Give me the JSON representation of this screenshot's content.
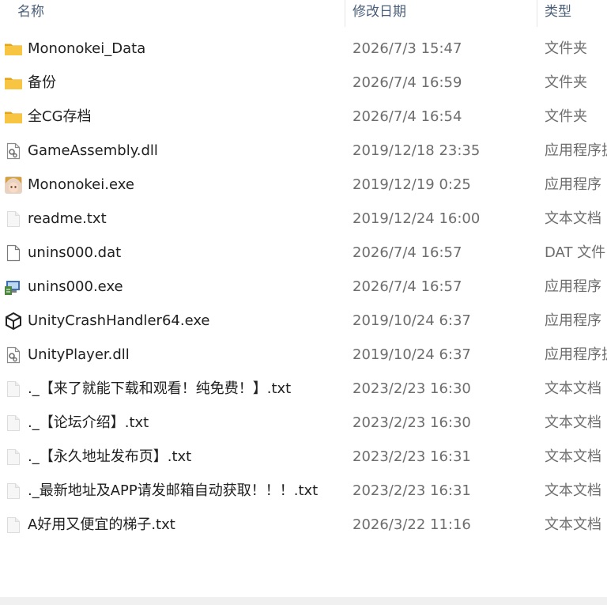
{
  "columns": {
    "name": "名称",
    "date": "修改日期",
    "type": "类型"
  },
  "files": [
    {
      "name": "Mononokei_Data",
      "date": "2026/7/3 15:47",
      "type": "文件夹",
      "icon": "folder-icon"
    },
    {
      "name": "备份",
      "date": "2026/7/4 16:59",
      "type": "文件夹",
      "icon": "folder-icon"
    },
    {
      "name": "全CG存档",
      "date": "2026/7/4 16:54",
      "type": "文件夹",
      "icon": "folder-icon"
    },
    {
      "name": "GameAssembly.dll",
      "date": "2019/12/18 23:35",
      "type": "应用程序扩展",
      "icon": "dll-file-icon"
    },
    {
      "name": "Mononokei.exe",
      "date": "2019/12/19 0:25",
      "type": "应用程序",
      "icon": "game-exe-icon"
    },
    {
      "name": "readme.txt",
      "date": "2019/12/24 16:00",
      "type": "文本文档",
      "icon": "text-file-icon"
    },
    {
      "name": "unins000.dat",
      "date": "2026/7/4 16:57",
      "type": "DAT 文件",
      "icon": "blank-file-icon"
    },
    {
      "name": "unins000.exe",
      "date": "2026/7/4 16:57",
      "type": "应用程序",
      "icon": "uninstaller-icon"
    },
    {
      "name": "UnityCrashHandler64.exe",
      "date": "2019/10/24 6:37",
      "type": "应用程序",
      "icon": "unity-icon"
    },
    {
      "name": "UnityPlayer.dll",
      "date": "2019/10/24 6:37",
      "type": "应用程序扩展",
      "icon": "dll-file-icon"
    },
    {
      "name": "._【来了就能下载和观看！纯免费！】.txt",
      "date": "2023/2/23 16:30",
      "type": "文本文档",
      "icon": "text-file-icon"
    },
    {
      "name": "._【论坛介绍】.txt",
      "date": "2023/2/23 16:30",
      "type": "文本文档",
      "icon": "text-file-icon"
    },
    {
      "name": "._【永久地址发布页】.txt",
      "date": "2023/2/23 16:31",
      "type": "文本文档",
      "icon": "text-file-icon"
    },
    {
      "name": "._最新地址及APP请发邮箱自动获取！！！.txt",
      "date": "2023/2/23 16:31",
      "type": "文本文档",
      "icon": "text-file-icon"
    },
    {
      "name": "A好用又便宜的梯子.txt",
      "date": "2026/3/22 11:16",
      "type": "文本文档",
      "icon": "text-file-icon"
    }
  ],
  "colors": {
    "folder": "#f8c543",
    "folder_dark": "#e2a51c",
    "header_text": "#4c607a",
    "date_text": "#6d6d6d"
  }
}
